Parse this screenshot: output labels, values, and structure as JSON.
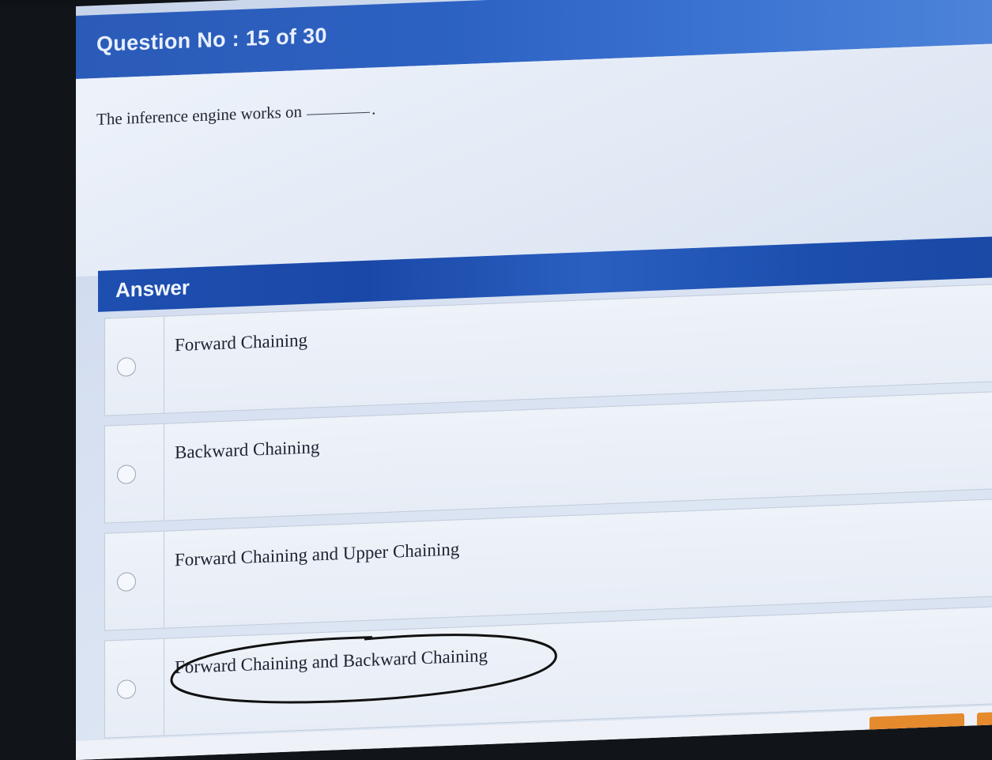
{
  "question": {
    "title": "Question No : 15 of 30",
    "text": "The inference engine works on"
  },
  "answer": {
    "title": "Answer",
    "options": [
      {
        "label": "Forward Chaining"
      },
      {
        "label": "Backward Chaining"
      },
      {
        "label": "Forward Chaining and Upper Chaining"
      },
      {
        "label": "Forward Chaining and Backward Chaining"
      }
    ]
  },
  "colors": {
    "header_blue": "#2c61c2",
    "answer_blue": "#1e4fb0",
    "button_orange": "#e58a2d"
  }
}
